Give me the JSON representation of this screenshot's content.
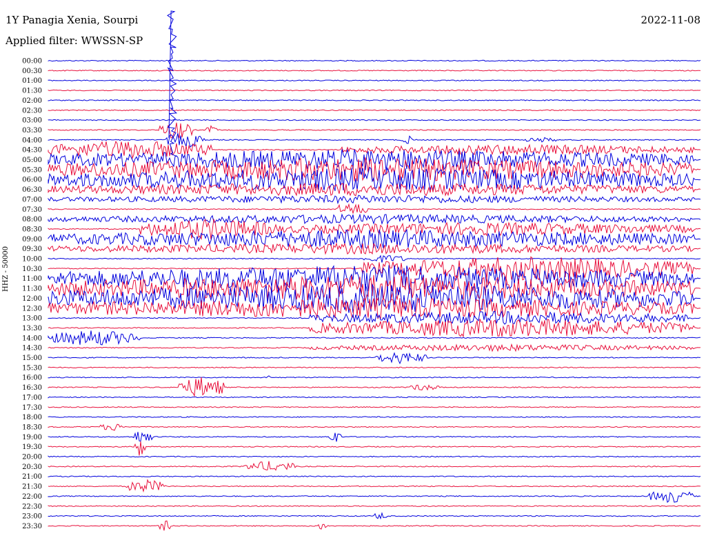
{
  "header": {
    "station": "1Y Panagia Xenia, Sourpi",
    "filter": "Applied filter: WWSSN-SP",
    "date": "2022-11-08"
  },
  "axis": {
    "ylabel": "HHZ - 50000"
  },
  "colors": {
    "primary": "#0000dd",
    "secondary": "#e8103c",
    "background": "#ffffff"
  },
  "chart_data": {
    "type": "line",
    "title": "1Y Panagia Xenia, Sourpi",
    "subtitle": "Applied filter: WWSSN-SP",
    "date": "2022-11-08",
    "ylabel": "HHZ - 50000",
    "row_labels": [
      "00:00",
      "00:30",
      "01:00",
      "01:30",
      "02:00",
      "02:30",
      "03:00",
      "03:30",
      "04:00",
      "04:30",
      "05:00",
      "05:30",
      "06:00",
      "06:30",
      "07:00",
      "07:30",
      "08:00",
      "08:30",
      "09:00",
      "09:30",
      "10:00",
      "10:30",
      "11:00",
      "11:30",
      "12:00",
      "12:30",
      "13:00",
      "13:30",
      "14:00",
      "14:30",
      "15:00",
      "15:30",
      "16:00",
      "16:30",
      "17:00",
      "17:30",
      "18:00",
      "18:30",
      "19:00",
      "19:30",
      "20:00",
      "20:30",
      "21:00",
      "21:30",
      "22:00",
      "22:30",
      "23:00",
      "23:30"
    ],
    "row_colors": [
      "primary",
      "secondary"
    ],
    "grid": false
  }
}
